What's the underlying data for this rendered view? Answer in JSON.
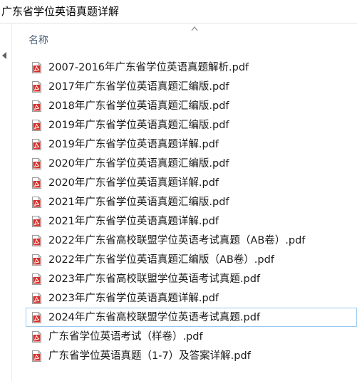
{
  "window": {
    "title": "广东省学位英语真题详解"
  },
  "column_header": {
    "name_label": "名称"
  },
  "colors": {
    "pdf_icon_red": "#d9302b",
    "selection_border": "#99c9ef",
    "header_text": "#4c607a"
  },
  "files": [
    {
      "name": "2007-2016年广东省学位英语真题解析.pdf",
      "icon": "pdf-icon"
    },
    {
      "name": "2017年广东省学位英语真题汇编版.pdf",
      "icon": "pdf-icon"
    },
    {
      "name": "2018年广东省学位英语真题汇编版.pdf",
      "icon": "pdf-icon"
    },
    {
      "name": "2019年广东省学位英语真题汇编版.pdf",
      "icon": "pdf-icon"
    },
    {
      "name": "2019年广东省学位英语真题详解.pdf",
      "icon": "pdf-icon"
    },
    {
      "name": "2020年广东省学位英语真题汇编版.pdf",
      "icon": "pdf-icon"
    },
    {
      "name": "2020年广东省学位英语真题详解.pdf",
      "icon": "pdf-icon"
    },
    {
      "name": "2021年广东省学位英语真题汇编版.pdf",
      "icon": "pdf-icon"
    },
    {
      "name": "2021年广东省学位英语真题详解.pdf",
      "icon": "pdf-icon"
    },
    {
      "name": "2022年广东省高校联盟学位英语考试真题（AB卷）.pdf",
      "icon": "pdf-icon"
    },
    {
      "name": "2022年广东省学位英语真题汇编版（AB卷）.pdf",
      "icon": "pdf-icon"
    },
    {
      "name": "2023年广东省高校联盟学位英语考试真题.pdf",
      "icon": "pdf-icon"
    },
    {
      "name": "2023年广东省学位英语真题详解.pdf",
      "icon": "pdf-icon"
    },
    {
      "name": "2024年广东省高校联盟学位英语考试真题.pdf",
      "icon": "pdf-icon",
      "selected": true
    },
    {
      "name": "广东省学位英语考试（样卷）.pdf",
      "icon": "pdf-icon"
    },
    {
      "name": "广东省学位英语真题（1-7）及答案详解.pdf",
      "icon": "pdf-icon"
    }
  ]
}
